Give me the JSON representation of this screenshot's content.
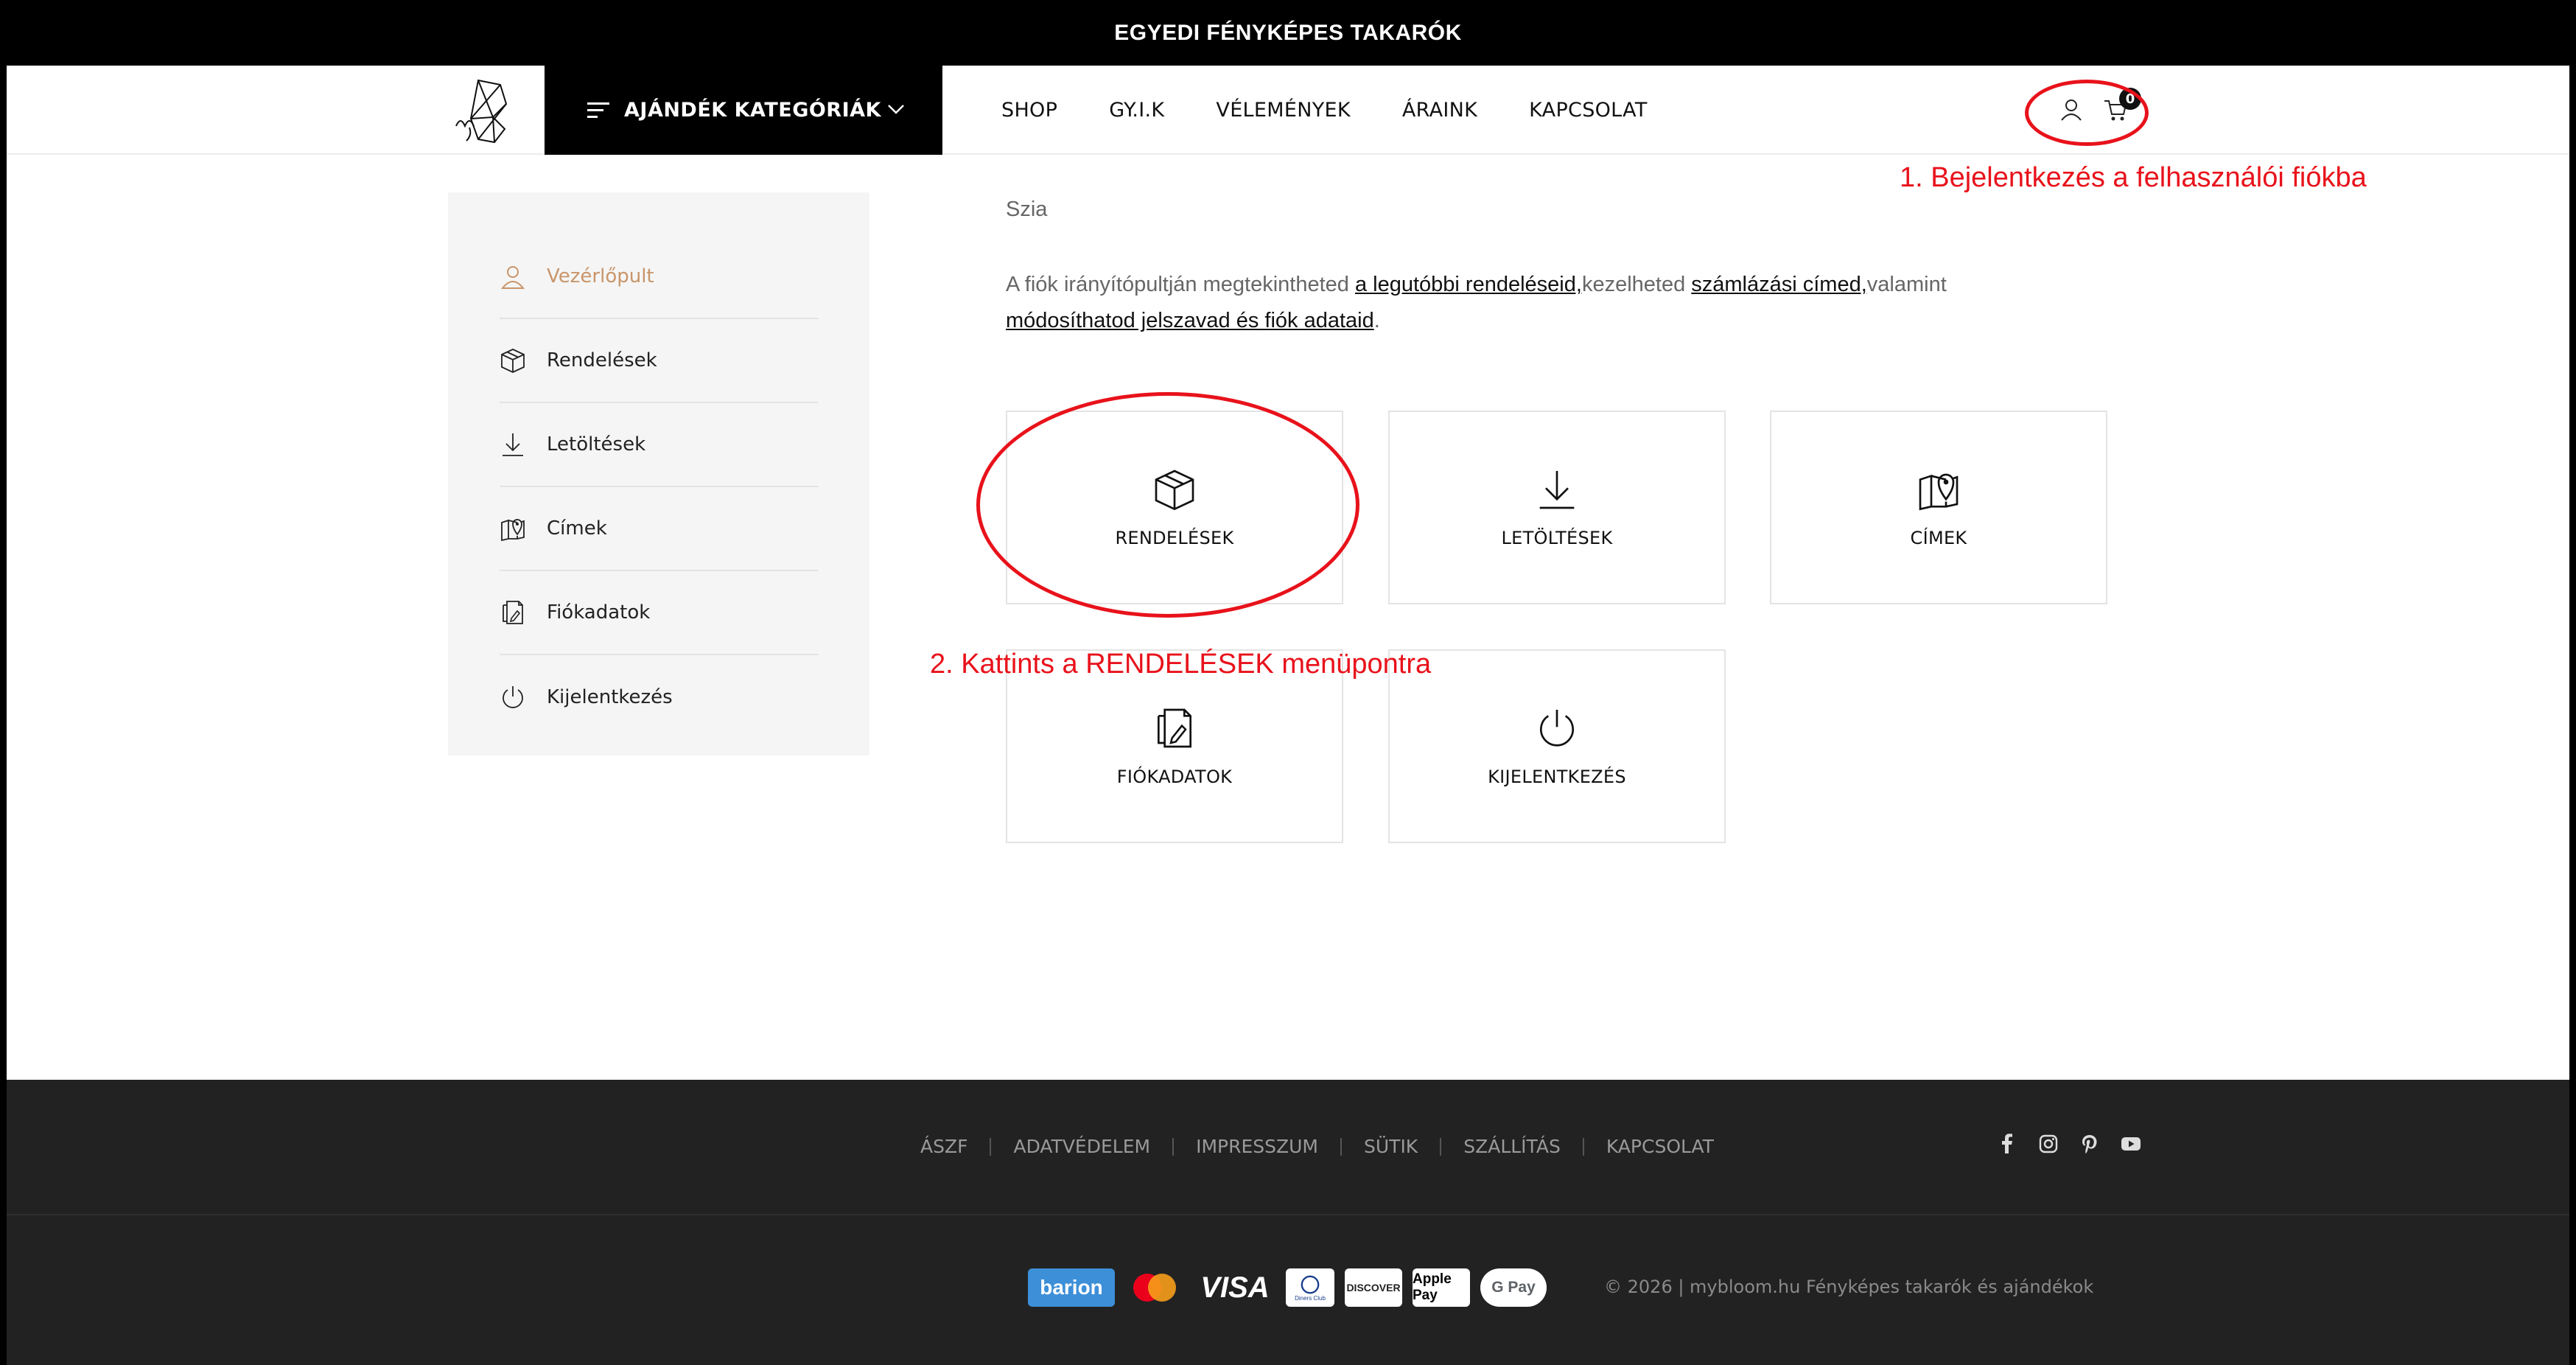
{
  "topbar": {
    "text": "EGYEDI FÉNYKÉPES TAKARÓK"
  },
  "header": {
    "categories_label": "AJÁNDÉK KATEGÓRIÁK",
    "nav": [
      "SHOP",
      "GY.I.K",
      "VÉLEMÉNYEK",
      "ÁRAINK",
      "KAPCSOLAT"
    ],
    "cart_count": "0"
  },
  "annotations": {
    "step1": "1. Bejelentkezés a felhasználói fiókba",
    "step2": "2. Kattints a RENDELÉSEK menüpontra",
    "color": "#e8121b"
  },
  "sidebar": {
    "items": [
      {
        "label": "Vezérlőpult",
        "icon": "user-icon",
        "active": true
      },
      {
        "label": "Rendelések",
        "icon": "box-icon",
        "active": false
      },
      {
        "label": "Letöltések",
        "icon": "download-icon",
        "active": false
      },
      {
        "label": "Címek",
        "icon": "map-pin-icon",
        "active": false
      },
      {
        "label": "Fiókadatok",
        "icon": "document-icon",
        "active": false
      },
      {
        "label": "Kijelentkezés",
        "icon": "power-icon",
        "active": false
      }
    ]
  },
  "main": {
    "greeting": "Szia",
    "intro": {
      "t1": "A fiók irányítópultján megtekintheted ",
      "link1": "a legutóbbi rendeléseid,",
      "t2": "kezelheted ",
      "link2": "számlázási címed,",
      "t3": "valamint ",
      "link3": "módosíthatod jelszavad és fiók adataid",
      "t4": "."
    },
    "cards": [
      {
        "label": "RENDELÉSEK",
        "icon": "box-icon"
      },
      {
        "label": "LETÖLTÉSEK",
        "icon": "download-icon"
      },
      {
        "label": "CÍMEK",
        "icon": "map-pin-icon"
      },
      {
        "label": "FIÓKADATOK",
        "icon": "document-icon"
      },
      {
        "label": "KIJELENTKEZÉS",
        "icon": "power-icon"
      }
    ]
  },
  "footer": {
    "links": [
      "ÁSZF",
      "ADATVÉDELEM",
      "IMPRESSZUM",
      "SÜTIK",
      "SZÁLLÍTÁS",
      "KAPCSOLAT"
    ],
    "socials": [
      "facebook-icon",
      "instagram-icon",
      "pinterest-icon",
      "youtube-icon"
    ],
    "payments": [
      "barion",
      "Mastercard",
      "VISA",
      "Diners Club",
      "DISCOVER",
      "Apple Pay",
      "G Pay"
    ],
    "copyright": "© 2026 | mybloom.hu Fényképes takarók és ajándékok"
  },
  "colors": {
    "accent": "#c8956a",
    "dark": "#222222",
    "black": "#000000"
  }
}
